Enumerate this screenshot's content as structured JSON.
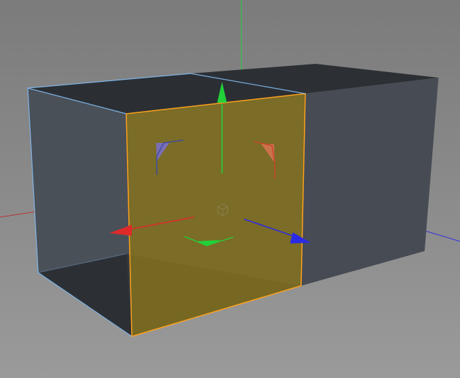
{
  "viewport": {
    "background_top": "#7b7b7b",
    "background_bottom": "#9a9a9a",
    "grid_dot_color": "#8f8f8f"
  },
  "colors": {
    "x_axis": "#e02a2a",
    "y_axis": "#22d13a",
    "z_axis": "#2a2ae6",
    "selected_polygon_fill": "#7a6a22",
    "selected_polygon_edge": "#ffa21b",
    "object_edge": "#7fb4e6",
    "box_face_dark": "#2c3035",
    "box_face_mid": "#4a5058",
    "box_face_right": "#474c54",
    "box_top_dark": "#2b2f34"
  },
  "icons": {
    "move_x_arrow": "arrow-x-icon",
    "move_y_arrow": "arrow-y-icon",
    "move_z_arrow": "arrow-z-icon",
    "rotate_plane_xy": "plane-xy-handle-icon",
    "rotate_plane_yz": "plane-yz-handle-icon",
    "rotate_plane_xz": "plane-xz-handle-icon",
    "object_center": "cube-pivot-icon"
  }
}
